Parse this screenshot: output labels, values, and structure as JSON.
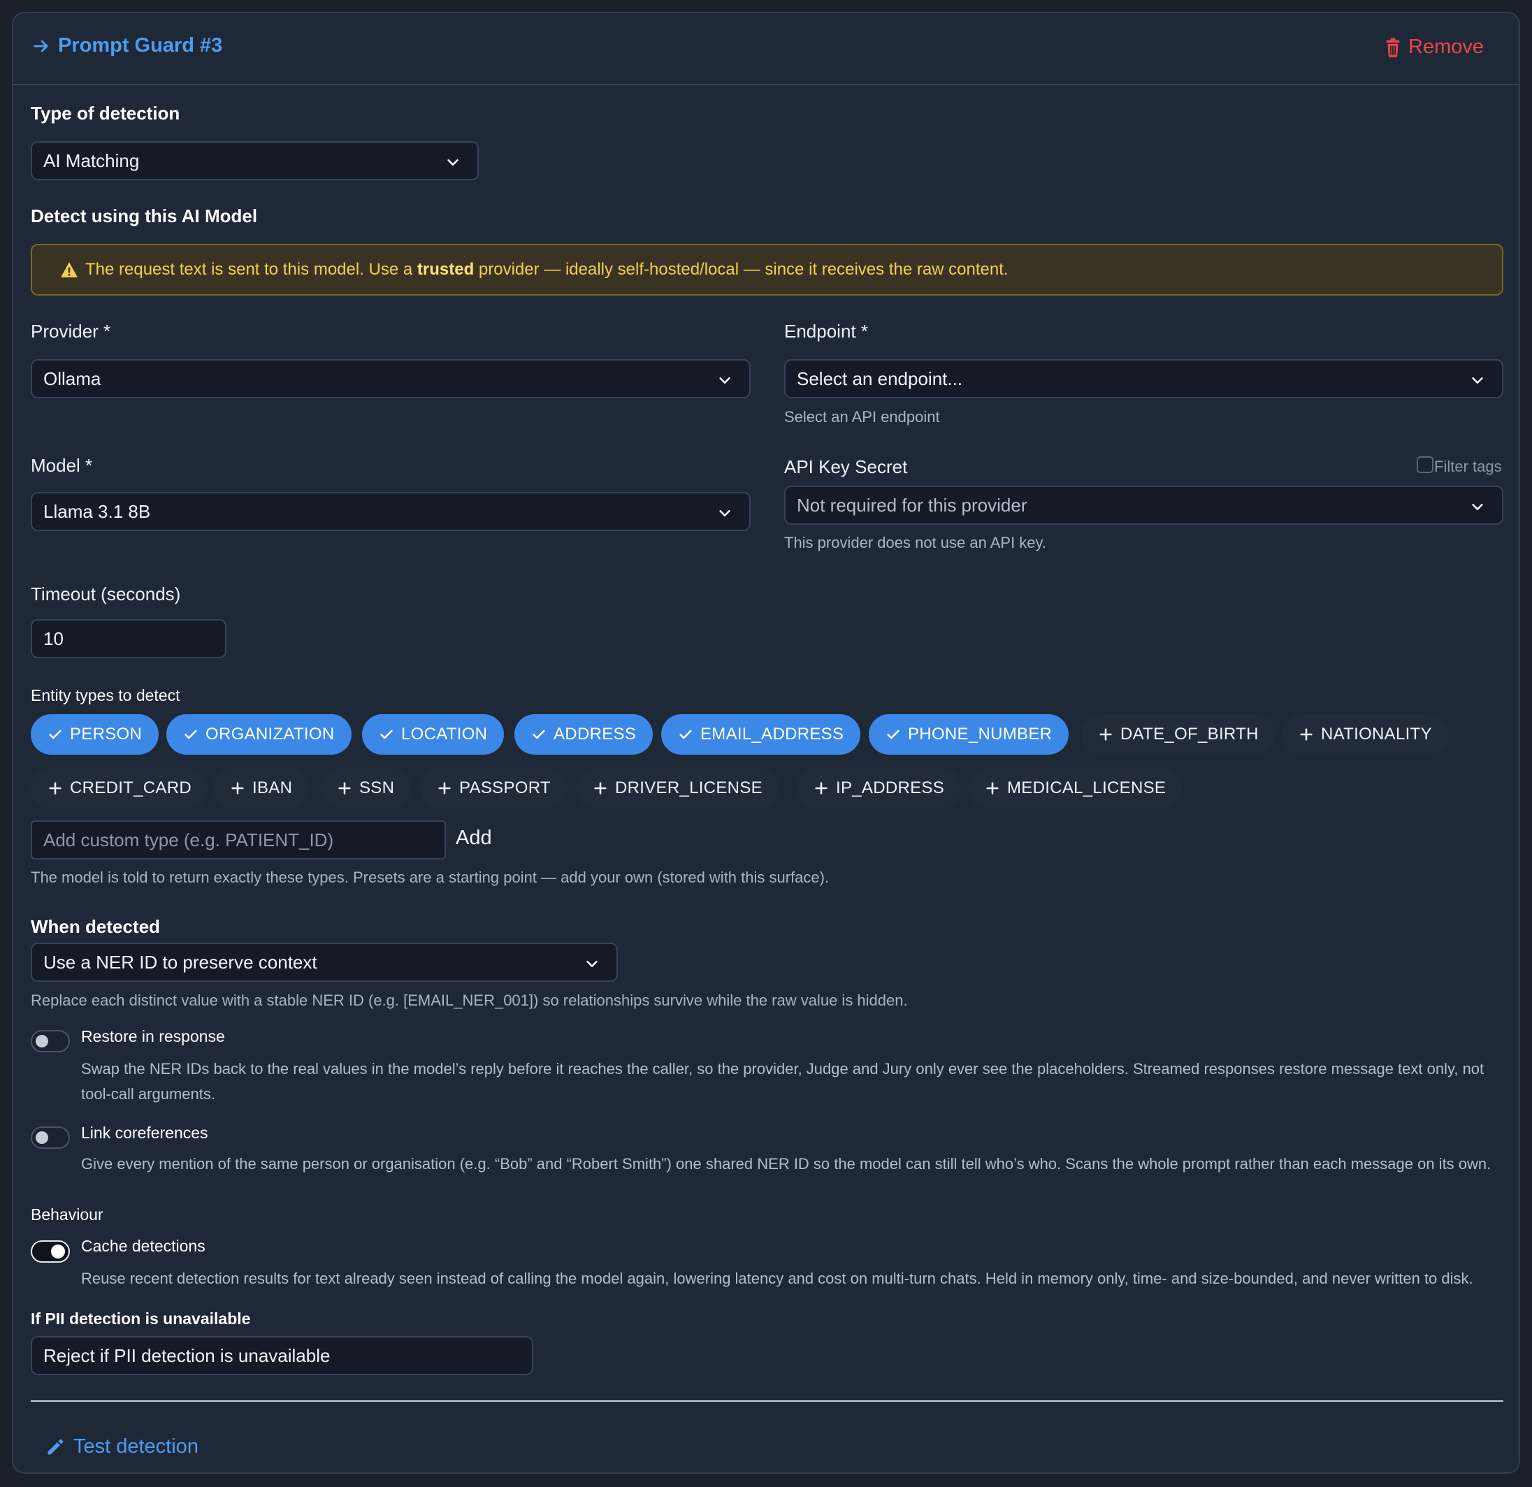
{
  "header": {
    "title": "Prompt Guard #3",
    "remove_label": "Remove"
  },
  "detection_type": {
    "label": "Type of detection",
    "value": "AI Matching"
  },
  "ai_model": {
    "section_label": "Detect using this AI Model",
    "warning": {
      "before": "The request text is sent to this model. Use a ",
      "bold": "trusted",
      "after": " provider — ideally self-hosted/local — since it receives the raw content."
    },
    "provider": {
      "label": "Provider *",
      "value": "Ollama"
    },
    "endpoint": {
      "label": "Endpoint *",
      "placeholder": "Select an endpoint...",
      "hint": "Select an API endpoint"
    },
    "model": {
      "label": "Model *",
      "value": "Llama 3.1 8B"
    },
    "api_key": {
      "label": "API Key Secret",
      "filter_label": "Filter tags",
      "value": "Not required for this provider",
      "hint": "This provider does not use an API key."
    },
    "timeout": {
      "label": "Timeout (seconds)",
      "value": "10"
    }
  },
  "entities": {
    "label": "Entity types to detect",
    "selected": [
      "PERSON",
      "ORGANIZATION",
      "LOCATION",
      "ADDRESS",
      "EMAIL_ADDRESS",
      "PHONE_NUMBER"
    ],
    "available": [
      "DATE_OF_BIRTH",
      "NATIONALITY",
      "CREDIT_CARD",
      "IBAN",
      "SSN",
      "PASSPORT",
      "DRIVER_LICENSE",
      "IP_ADDRESS",
      "MEDICAL_LICENSE"
    ],
    "custom_placeholder": "Add custom type (e.g. PATIENT_ID)",
    "add_label": "Add",
    "hint": "The model is told to return exactly these types. Presets are a starting point — add your own (stored with this surface)."
  },
  "when_detected": {
    "label": "When detected",
    "value": "Use a NER ID to preserve context",
    "hint": "Replace each distinct value with a stable NER ID (e.g. [EMAIL_NER_001]) so relationships survive while the raw value is hidden.",
    "restore": {
      "label": "Restore in response",
      "enabled": false,
      "desc_line1": "Swap the NER IDs back to the real values in the model’s reply before it reaches the caller, so the provider, Judge and Jury only ever see the placeholders. Streamed responses restore message text only, not",
      "desc_line2": "tool-call arguments."
    },
    "coref": {
      "label": "Link coreferences",
      "enabled": false,
      "desc": "Give every mention of the same person or organisation (e.g. “Bob” and “Robert Smith”) one shared NER ID so the model can still tell who’s who. Scans the whole prompt rather than each message on its own."
    }
  },
  "behaviour": {
    "label": "Behaviour",
    "cache": {
      "label": "Cache detections",
      "enabled": true,
      "desc": "Reuse recent detection results for text already seen instead of calling the model again, lowering latency and cost on multi-turn chats. Held in memory only, time- and size-bounded, and never written to disk."
    }
  },
  "unavailable": {
    "label": "If PII detection is unavailable",
    "value": "Reject if PII detection is unavailable"
  },
  "test": {
    "label": "Test detection"
  },
  "colors": {
    "accent": "#4c9cf0",
    "danger": "#ef4444",
    "warning_text": "#f3cf52",
    "chip_selected": "#3b88e6"
  }
}
